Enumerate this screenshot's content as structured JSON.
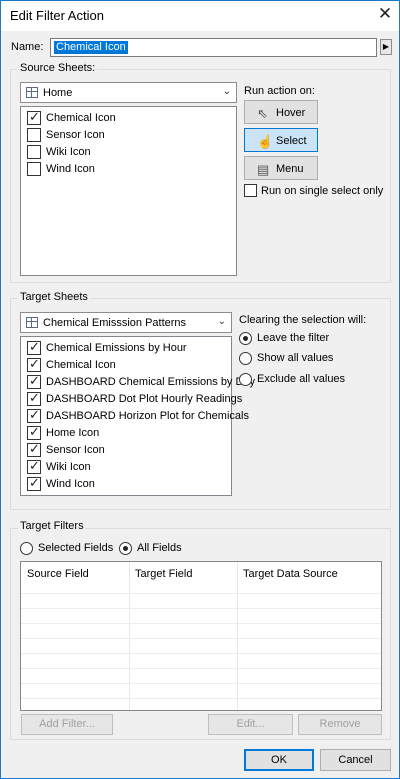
{
  "window": {
    "title": "Edit Filter Action"
  },
  "name": {
    "label": "Name:",
    "value": "Chemical Icon"
  },
  "source_sheets": {
    "label": "Source Sheets:",
    "selected": "Home",
    "items": [
      {
        "label": "Chemical Icon",
        "checked": true
      },
      {
        "label": "Sensor Icon",
        "checked": false
      },
      {
        "label": "Wiki Icon",
        "checked": false
      },
      {
        "label": "Wind Icon",
        "checked": false
      }
    ]
  },
  "run_action": {
    "label": "Run action on:",
    "hover": "Hover",
    "select": "Select",
    "menu": "Menu",
    "single_select": "Run on single select only"
  },
  "target_sheets": {
    "label": "Target Sheets",
    "selected": "Chemical Emisssion Patterns",
    "items": [
      {
        "label": "Chemical Emissions by Hour",
        "checked": true
      },
      {
        "label": "Chemical Icon",
        "checked": true
      },
      {
        "label": "DASHBOARD Chemical Emissions by Day",
        "checked": true
      },
      {
        "label": "DASHBOARD Dot Plot Hourly Readings",
        "checked": true
      },
      {
        "label": "DASHBOARD Horizon Plot for Chemicals",
        "checked": true
      },
      {
        "label": "Home Icon",
        "checked": true
      },
      {
        "label": "Sensor Icon",
        "checked": true
      },
      {
        "label": "Wiki Icon",
        "checked": true
      },
      {
        "label": "Wind Icon",
        "checked": true
      }
    ]
  },
  "clearing": {
    "label": "Clearing the selection will:",
    "options": [
      "Leave the filter",
      "Show all values",
      "Exclude all values"
    ],
    "selected_index": 0
  },
  "target_filters": {
    "label": "Target Filters",
    "selected_fields": "Selected Fields",
    "all_fields": "All Fields",
    "columns": [
      "Source Field",
      "Target Field",
      "Target Data Source"
    ],
    "add_filter": "Add Filter...",
    "edit": "Edit...",
    "remove": "Remove"
  },
  "footer": {
    "ok": "OK",
    "cancel": "Cancel"
  }
}
